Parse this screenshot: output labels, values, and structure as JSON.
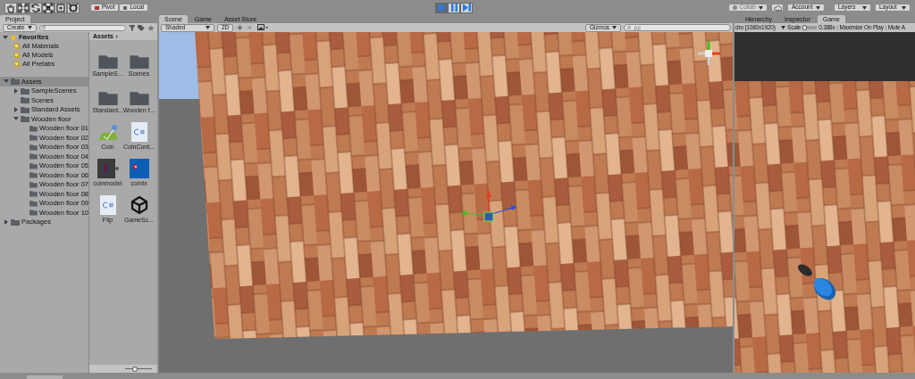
{
  "toolbar": {
    "tools": [
      {
        "kind": "hand",
        "selected": false
      },
      {
        "kind": "move",
        "selected": true
      },
      {
        "kind": "rotate",
        "selected": false
      },
      {
        "kind": "scale",
        "selected": false
      },
      {
        "kind": "rect",
        "selected": false
      },
      {
        "kind": "transform",
        "selected": false
      }
    ],
    "pivot": "Pivot",
    "space": "Local",
    "play_controls": [
      {
        "kind": "play",
        "selected": true
      },
      {
        "kind": "pause",
        "selected": false
      },
      {
        "kind": "step",
        "selected": false
      }
    ],
    "collab": "Collab",
    "account": "Account",
    "layers": "Layers",
    "layout": "Layout"
  },
  "project": {
    "tab": "Project",
    "create": "Create",
    "favorites": {
      "label": "Favorites",
      "items": [
        "All Materials",
        "All Models",
        "All Prefabs"
      ]
    },
    "tree": [
      {
        "label": "Assets",
        "selected": true,
        "expanded": true,
        "children": [
          {
            "label": "SampleScenes",
            "selected": false,
            "expanded": false
          },
          {
            "label": "Scenes",
            "selected": false
          },
          {
            "label": "Standard Assets",
            "selected": false,
            "expanded": false
          },
          {
            "label": "Wooden floor",
            "selected": false,
            "expanded": true,
            "children": [
              {
                "label": "Wooden floor 01",
                "selected": false
              },
              {
                "label": "Wooden floor 02",
                "selected": false
              },
              {
                "label": "Wooden floor 03",
                "selected": false
              },
              {
                "label": "Wooden floor 04",
                "selected": false
              },
              {
                "label": "Wooden floor 05",
                "selected": false
              },
              {
                "label": "Wooden floor 06",
                "selected": false
              },
              {
                "label": "Wooden floor 07",
                "selected": false
              },
              {
                "label": "Wooden floor 08",
                "selected": false
              },
              {
                "label": "Wooden floor 09",
                "selected": false
              },
              {
                "label": "Wooden floor 10",
                "selected": false
              }
            ]
          }
        ]
      },
      {
        "label": "Packages",
        "selected": false,
        "expanded": false
      }
    ],
    "grid_title": "Assets",
    "zoom": {
      "level": 0.35
    },
    "grid": [
      {
        "kind": "folder",
        "label": "SampleS..."
      },
      {
        "kind": "folder",
        "label": "Scenes"
      },
      {
        "kind": "folder",
        "label": "Standard..."
      },
      {
        "kind": "folder",
        "label": "Wooden f..."
      },
      {
        "kind": "material",
        "label": "Coin"
      },
      {
        "kind": "script",
        "label": "CoinCont..."
      },
      {
        "kind": "model",
        "label": "coinmodel"
      },
      {
        "kind": "texture",
        "label": "cointx"
      },
      {
        "kind": "script",
        "label": "Flip"
      },
      {
        "kind": "unity",
        "label": "GameSc..."
      }
    ]
  },
  "scene": {
    "tabs": [
      {
        "label": "Scene",
        "selected": true
      },
      {
        "label": "Game",
        "selected": false
      },
      {
        "label": "Asset Store",
        "selected": false
      }
    ],
    "shading": "Shaded",
    "mode_2d": "2D",
    "gizmos": "Gizmos",
    "search_placeholder": "All"
  },
  "side": {
    "tabs": [
      {
        "label": "Hierarchy",
        "selected": false
      },
      {
        "label": "Inspector",
        "selected": false
      },
      {
        "label": "Game",
        "selected": true
      }
    ],
    "resolution": "dro (1080x1920)",
    "scale_label": "Scale",
    "scale": {
      "level": 0.05
    },
    "scale_value": "0.388x",
    "maximize": "Maximize On Play",
    "mute": "Mute A"
  }
}
